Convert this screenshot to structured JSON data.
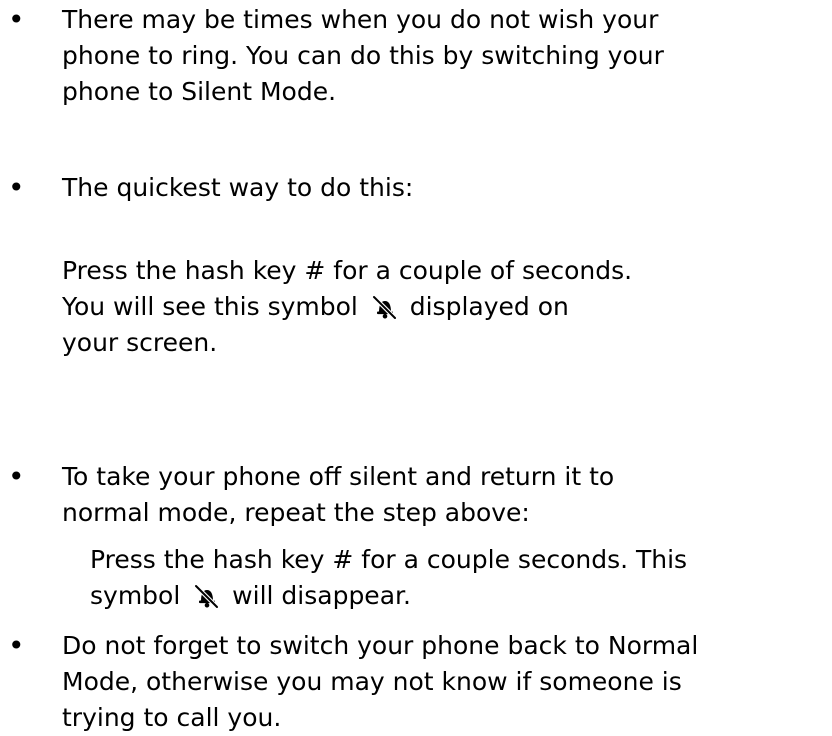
{
  "doc": {
    "bullet_char": "•",
    "item1": {
      "lines": [
        "There may be times when you do not wish your",
        "phone to ring. You can do this by switching your",
        "phone to Silent Mode."
      ]
    },
    "item2": {
      "lines": [
        "The quickest way to do this:"
      ]
    },
    "step1": {
      "line1": "Press the hash key # for a couple of seconds.",
      "line2_before": "You will see this symbol",
      "line2_after": "displayed on",
      "line3": "your screen."
    },
    "item3": {
      "lines": [
        "To take your phone off silent and return it to",
        "normal mode, repeat the step above:"
      ]
    },
    "step2": {
      "line1": "Press the hash key # for a couple seconds.  This",
      "line2_before": "symbol",
      "line2_after": "will disappear."
    },
    "item4": {
      "lines": [
        "Do not forget to switch your phone back to Normal",
        "Mode, otherwise you may not know if someone is",
        "trying to call you."
      ]
    },
    "icons": {
      "silent_symbol": "silent-mode-bell-muted-icon"
    },
    "colors": {
      "text": "#000000",
      "background": "#ffffff"
    }
  }
}
